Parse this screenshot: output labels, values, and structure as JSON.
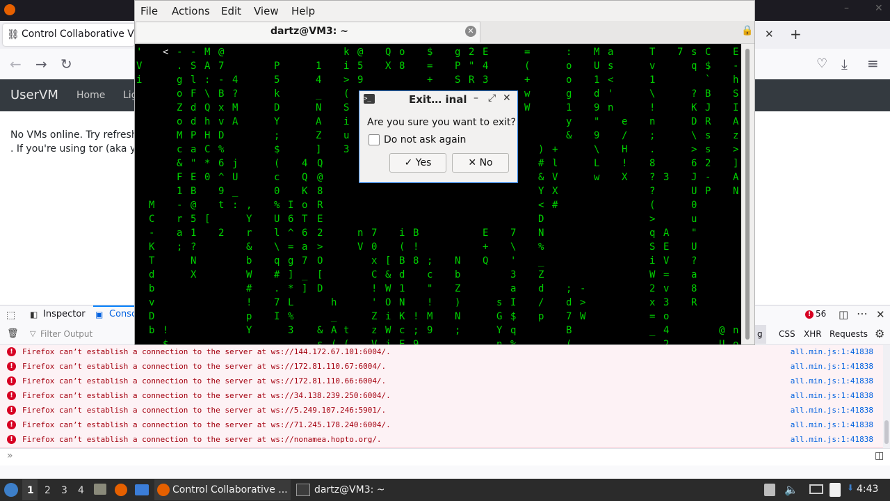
{
  "browser": {
    "tab_title": "Control Collaborative Vi",
    "site": {
      "brand": "UserVM",
      "nav_home": "Home",
      "nav_partial": "Lig",
      "message_line1": "No VMs online. Try refreshin",
      "message_line2": ". If you're using tor (aka you c"
    }
  },
  "devtools": {
    "tab_inspector": "Inspector",
    "tab_console": "Consc",
    "error_count": "56",
    "filter_placeholder": "Filter Output",
    "filter_partial": "g",
    "filter_css": "CSS",
    "filter_xhr": "XHR",
    "filter_requests": "Requests",
    "log": [
      {
        "text": "Firefox can’t establish a connection to the server at ws://144.172.67.101:6004/.",
        "source": "all.min.js:1:41838"
      },
      {
        "text": "Firefox can’t establish a connection to the server at ws://172.81.110.67:6004/.",
        "source": "all.min.js:1:41838"
      },
      {
        "text": "Firefox can’t establish a connection to the server at ws://172.81.110.66:6004/.",
        "source": "all.min.js:1:41838"
      },
      {
        "text": "Firefox can’t establish a connection to the server at ws://34.138.239.250:6004/.",
        "source": "all.min.js:1:41838"
      },
      {
        "text": "Firefox can’t establish a connection to the server at ws://5.249.107.246:5901/.",
        "source": "all.min.js:1:41838"
      },
      {
        "text": "Firefox can’t establish a connection to the server at ws://71.245.178.240:6004/.",
        "source": "all.min.js:1:41838"
      },
      {
        "text": "Firefox can’t establish a connection to the server at ws://nonamea.hopto.org/.",
        "source": "all.min.js:1:41838"
      }
    ]
  },
  "terminal": {
    "menu": {
      "file": "File",
      "actions": "Actions",
      "edit": "Edit",
      "view": "View",
      "help": "Help"
    },
    "tab_title": "dartz@VM3: ~"
  },
  "dialog": {
    "title": "Exit… inal",
    "message": "Are you sure you want to exit?",
    "checkbox_label": "Do not ask again",
    "checkbox_checked": false,
    "yes_label": "Yes",
    "no_label": "No"
  },
  "taskbar": {
    "workspaces": [
      "1",
      "2",
      "3",
      "4"
    ],
    "task_firefox": "Control Collaborative ...",
    "task_terminal": "dartz@VM3: ~",
    "clock": "4:43"
  },
  "colors": {
    "matrix_green": "#00d000",
    "error_red": "#d70022",
    "dialog_border": "#3584e4"
  }
}
